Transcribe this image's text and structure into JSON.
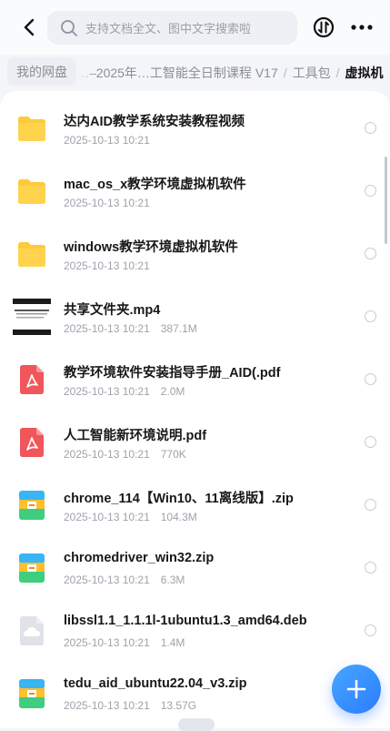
{
  "search": {
    "placeholder": "支持文档全文、图中文字搜索啦"
  },
  "breadcrumb": {
    "root": "我的网盘",
    "segments": [
      "…–2025年…工智能全日制课程 V17",
      "工具包"
    ],
    "current": "虚拟机"
  },
  "files": [
    {
      "name": "达内AID教学系统安装教程视频",
      "date": "2025-10-13 10:21",
      "size": "",
      "type": "folder"
    },
    {
      "name": "mac_os_x教学环境虚拟机软件",
      "date": "2025-10-13 10:21",
      "size": "",
      "type": "folder"
    },
    {
      "name": "windows教学环境虚拟机软件",
      "date": "2025-10-13 10:21",
      "size": "",
      "type": "folder"
    },
    {
      "name": "共享文件夹.mp4",
      "date": "2025-10-13 10:21",
      "size": "387.1M",
      "type": "video"
    },
    {
      "name": "教学环境软件安装指导手册_AID(.pdf",
      "date": "2025-10-13 10:21",
      "size": "2.0M",
      "type": "pdf"
    },
    {
      "name": "人工智能新环境说明.pdf",
      "date": "2025-10-13 10:21",
      "size": "770K",
      "type": "pdf"
    },
    {
      "name": "chrome_114【Win10、11离线版】.zip",
      "date": "2025-10-13 10:21",
      "size": "104.3M",
      "type": "zip"
    },
    {
      "name": "chromedriver_win32.zip",
      "date": "2025-10-13 10:21",
      "size": "6.3M",
      "type": "zip"
    },
    {
      "name": "libssl1.1_1.1.1l-1ubuntu1.3_amd64.deb",
      "date": "2025-10-13 10:21",
      "size": "1.4M",
      "type": "deb"
    },
    {
      "name": "tedu_aid_ubuntu22.04_v3.zip",
      "date": "2025-10-13 10:21",
      "size": "13.57G",
      "type": "zip"
    }
  ],
  "icons": {
    "back": "chevron-left-icon",
    "search": "search-icon",
    "transfer": "transfer-icon",
    "more": "more-dots-icon",
    "fab": "plus-icon"
  },
  "colors": {
    "folder": "#fdcb3a",
    "pdf": "#f0565b",
    "fab": "#2b7cff"
  }
}
